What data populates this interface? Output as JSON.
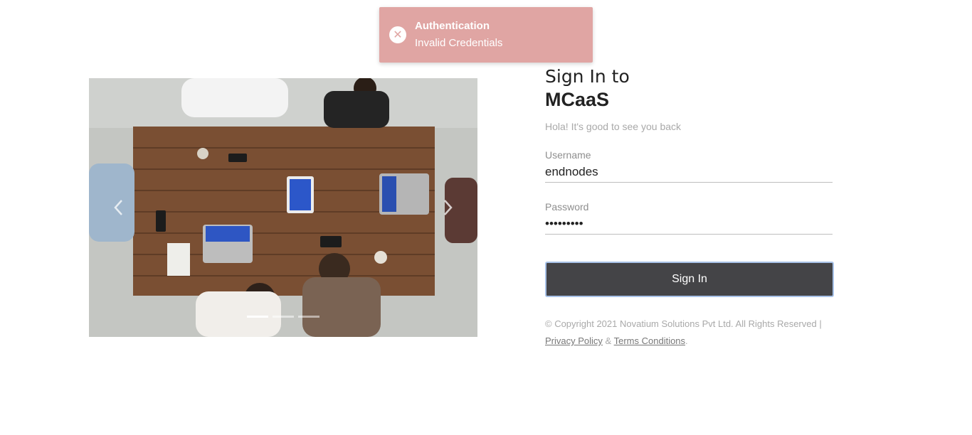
{
  "toast": {
    "icon": "close-circle-icon",
    "title": "Authentication",
    "message": "Invalid Credentials"
  },
  "carousel": {
    "image": "team-meeting-photo",
    "prev_icon": "chevron-left-icon",
    "next_icon": "chevron-right-icon",
    "slides": 3,
    "active_slide": 1
  },
  "form": {
    "title_line1": "Sign In to",
    "title_line2": "MCaaS",
    "subtitle": "Hola! It's good to see you back",
    "username_label": "Username",
    "username_value": "endnodes",
    "password_label": "Password",
    "password_value": "•••••••••",
    "submit_label": "Sign In"
  },
  "footer": {
    "copyright": "© Copyright 2021 Novatium Solutions Pvt Ltd. All Rights Reserved |",
    "privacy_link": "Privacy Policy",
    "ampersand": "&",
    "terms_link": "Terms Conditions",
    "period": "."
  },
  "colors": {
    "toast_bg": "#e0a5a3",
    "button_bg": "#444447",
    "button_border": "#a8c2e8"
  }
}
